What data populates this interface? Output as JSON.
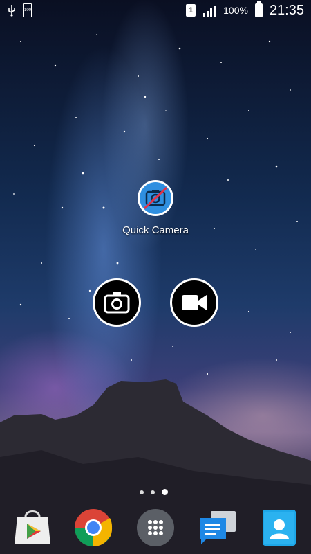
{
  "status_bar": {
    "battery_small_label": "100",
    "sim_label": "1",
    "battery_percent": "100%",
    "time": "21:35",
    "icons": [
      "usb-icon",
      "battery-saver-icon",
      "sim-icon",
      "signal-icon",
      "battery-icon"
    ]
  },
  "home": {
    "app_label": "Quick Camera",
    "app_icon": "quick-camera-icon",
    "shortcut_buttons": [
      "photo-camera-icon",
      "video-camera-icon"
    ],
    "page_indicator": {
      "pages": 3,
      "current": 3
    }
  },
  "dock": {
    "apps": [
      "play-store-icon",
      "chrome-icon",
      "app-drawer-icon",
      "messages-icon",
      "contacts-icon"
    ]
  }
}
